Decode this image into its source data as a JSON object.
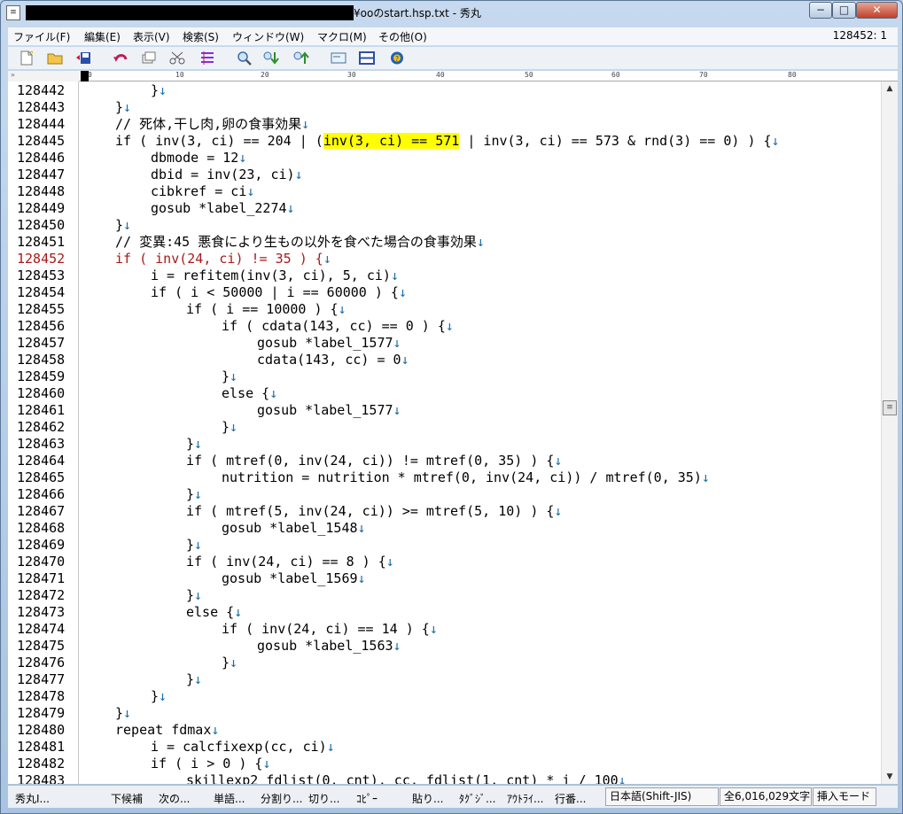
{
  "window": {
    "title": "¥ooのstart.hsp.txt  - 秀丸",
    "min_label": "−",
    "max_label": "□",
    "close_label": "✕"
  },
  "menu": {
    "items": [
      "ファイル(F)",
      "編集(E)",
      "表示(V)",
      "検索(S)",
      "ウィンドウ(W)",
      "マクロ(M)",
      "その他(O)"
    ],
    "cursor_position": "128452: 1"
  },
  "ruler": {
    "marks": [
      "0",
      "10",
      "20",
      "30",
      "40",
      "50",
      "60",
      "70",
      "80"
    ],
    "gutter_mark": "»"
  },
  "editor": {
    "lines": [
      {
        "no": "128442",
        "indent": 12,
        "text": "}",
        "arrow": true
      },
      {
        "no": "128443",
        "indent": 8,
        "text": "}",
        "arrow": true
      },
      {
        "no": "128444",
        "indent": 8,
        "text": "// 死体,干し肉,卵の食事効果",
        "arrow": true
      },
      {
        "no": "128445",
        "indent": 8,
        "pre": "if ( inv(3, ci) == 204 | (",
        "hl": "inv(3, ci) == 571",
        "post": " | inv(3, ci) == 573 & rnd(3) == 0) ) {",
        "arrow": true
      },
      {
        "no": "128446",
        "indent": 12,
        "text": "dbmode = 12",
        "arrow": true
      },
      {
        "no": "128447",
        "indent": 12,
        "text": "dbid = inv(23, ci)",
        "arrow": true
      },
      {
        "no": "128448",
        "indent": 12,
        "text": "cibkref = ci",
        "arrow": true
      },
      {
        "no": "128449",
        "indent": 12,
        "text": "gosub *label_2274",
        "arrow": true
      },
      {
        "no": "128450",
        "indent": 8,
        "text": "}",
        "arrow": true
      },
      {
        "no": "128451",
        "indent": 8,
        "text": "// 変異:45 悪食により生もの以外を食べた場合の食事効果",
        "arrow": true
      },
      {
        "no": "128452",
        "indent": 8,
        "text": "if ( inv(24, ci) != 35 ) {",
        "arrow": true,
        "current": true
      },
      {
        "no": "128453",
        "indent": 12,
        "text": "i = refitem(inv(3, ci), 5, ci)",
        "arrow": true
      },
      {
        "no": "128454",
        "indent": 12,
        "text": "if ( i < 50000 | i == 60000 ) {",
        "arrow": true
      },
      {
        "no": "128455",
        "indent": 16,
        "text": "if ( i == 10000 ) {",
        "arrow": true
      },
      {
        "no": "128456",
        "indent": 20,
        "text": "if ( cdata(143, cc) == 0 ) {",
        "arrow": true
      },
      {
        "no": "128457",
        "indent": 24,
        "text": "gosub *label_1577",
        "arrow": true
      },
      {
        "no": "128458",
        "indent": 24,
        "text": "cdata(143, cc) = 0",
        "arrow": true
      },
      {
        "no": "128459",
        "indent": 20,
        "text": "}",
        "arrow": true
      },
      {
        "no": "128460",
        "indent": 20,
        "text": "else {",
        "arrow": true
      },
      {
        "no": "128461",
        "indent": 24,
        "text": "gosub *label_1577",
        "arrow": true
      },
      {
        "no": "128462",
        "indent": 20,
        "text": "}",
        "arrow": true
      },
      {
        "no": "128463",
        "indent": 16,
        "text": "}",
        "arrow": true
      },
      {
        "no": "128464",
        "indent": 16,
        "text": "if ( mtref(0, inv(24, ci)) != mtref(0, 35) ) {",
        "arrow": true
      },
      {
        "no": "128465",
        "indent": 20,
        "text": "nutrition = nutrition * mtref(0, inv(24, ci)) / mtref(0, 35)",
        "arrow": true
      },
      {
        "no": "128466",
        "indent": 16,
        "text": "}",
        "arrow": true
      },
      {
        "no": "128467",
        "indent": 16,
        "text": "if ( mtref(5, inv(24, ci)) >= mtref(5, 10) ) {",
        "arrow": true
      },
      {
        "no": "128468",
        "indent": 20,
        "text": "gosub *label_1548",
        "arrow": true
      },
      {
        "no": "128469",
        "indent": 16,
        "text": "}",
        "arrow": true
      },
      {
        "no": "128470",
        "indent": 16,
        "text": "if ( inv(24, ci) == 8 ) {",
        "arrow": true
      },
      {
        "no": "128471",
        "indent": 20,
        "text": "gosub *label_1569",
        "arrow": true
      },
      {
        "no": "128472",
        "indent": 16,
        "text": "}",
        "arrow": true
      },
      {
        "no": "128473",
        "indent": 16,
        "text": "else {",
        "arrow": true
      },
      {
        "no": "128474",
        "indent": 20,
        "text": "if ( inv(24, ci) == 14 ) {",
        "arrow": true
      },
      {
        "no": "128475",
        "indent": 24,
        "text": "gosub *label_1563",
        "arrow": true
      },
      {
        "no": "128476",
        "indent": 20,
        "text": "}",
        "arrow": true
      },
      {
        "no": "128477",
        "indent": 16,
        "text": "}",
        "arrow": true
      },
      {
        "no": "128478",
        "indent": 12,
        "text": "}",
        "arrow": true
      },
      {
        "no": "128479",
        "indent": 8,
        "text": "}",
        "arrow": true
      },
      {
        "no": "128480",
        "indent": 8,
        "text": "repeat fdmax",
        "arrow": true
      },
      {
        "no": "128481",
        "indent": 12,
        "text": "i = calcfixexp(cc, ci)",
        "arrow": true
      },
      {
        "no": "128482",
        "indent": 12,
        "text": "if ( i > 0 ) {",
        "arrow": true
      },
      {
        "no": "128483",
        "indent": 16,
        "text": "skillexp2 fdlist(0, cnt), cc, fdlist(1, cnt) * i / 100",
        "arrow": true
      }
    ]
  },
  "statusbar": {
    "left_items": [
      "秀丸I...",
      "下候補",
      "次の...",
      "単語...",
      "分割り...",
      "切り...",
      "ｺﾋﾟｰ",
      "貼り...",
      "ﾀｸﾞｼﾞ...",
      "ｱｳﾄﾗｲ...",
      "行番..."
    ],
    "encoding": "日本語(Shift-JIS)",
    "char_count": "全6,016,029文字",
    "mode": "挿入モード"
  },
  "colors": {
    "highlight": "#ffff00",
    "current_line": "#a81a1a",
    "newline_arrow": "#1a6fa8"
  }
}
